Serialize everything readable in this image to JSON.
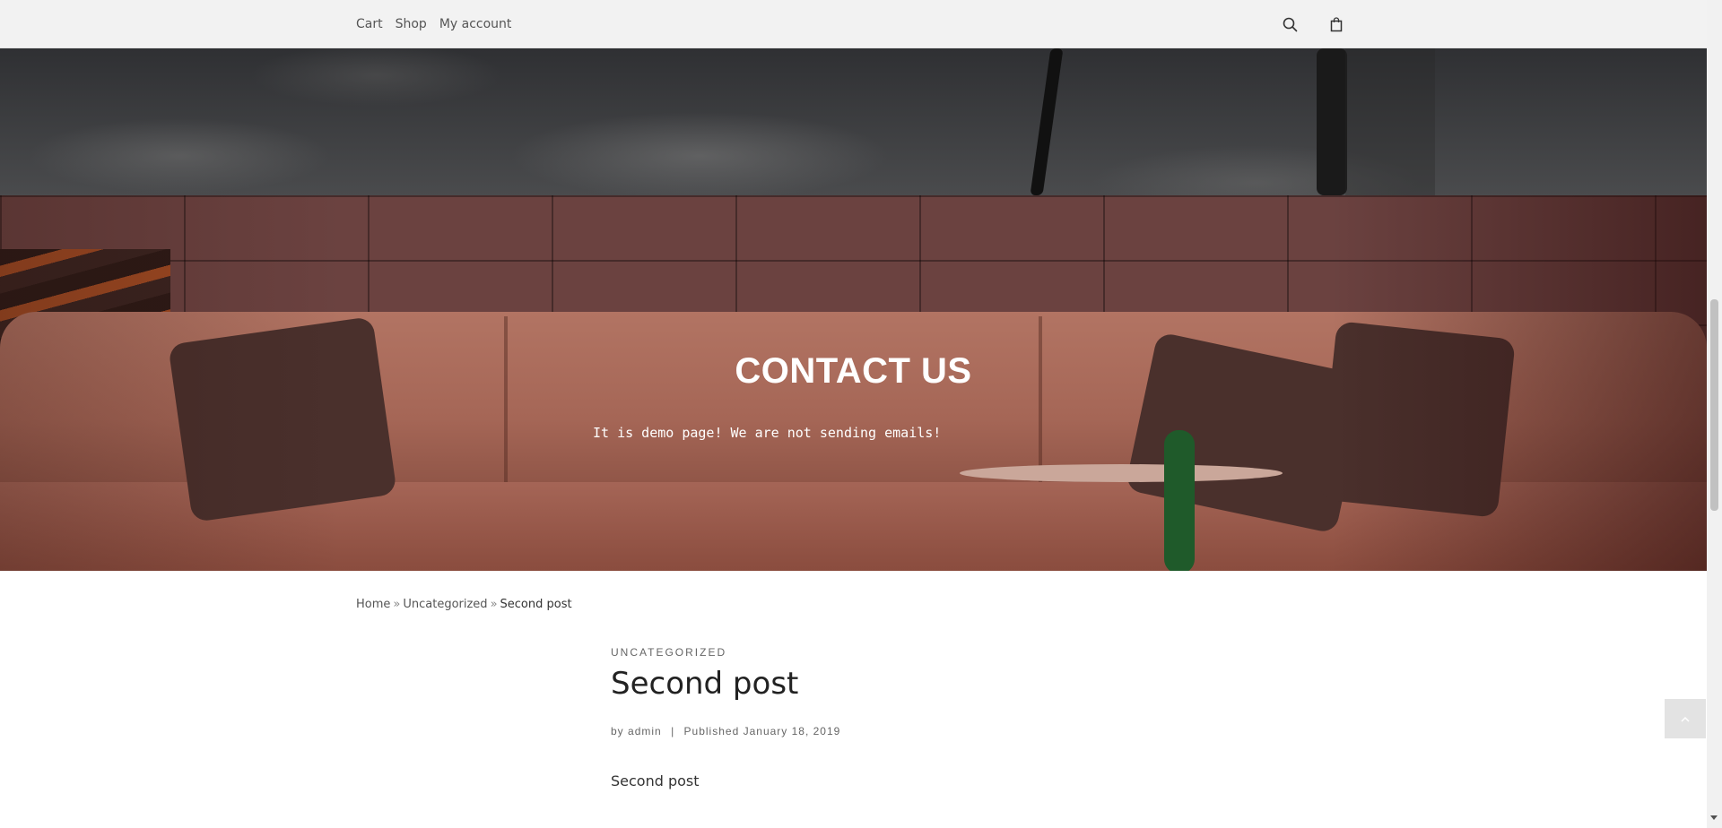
{
  "nav": {
    "items": [
      {
        "label": "Cart"
      },
      {
        "label": "Shop"
      },
      {
        "label": "My account"
      }
    ],
    "icons": {
      "search": "search-icon",
      "cart": "shopping-bag-icon"
    }
  },
  "hero": {
    "title": "CONTACT US",
    "subtitle": "It is demo page! We are not sending emails!"
  },
  "breadcrumb": {
    "home": "Home",
    "separator": "»",
    "category": "Uncategorized",
    "current": "Second post"
  },
  "post": {
    "category": "UNCATEGORIZED",
    "title": "Second post",
    "meta": {
      "by": "by",
      "author": "admin",
      "separator": "|",
      "published": "Published",
      "date": "January 18, 2019"
    },
    "body": "Second post"
  },
  "scroll_to_top": {
    "icon": "chevron-up-icon"
  },
  "colors": {
    "topbar": "#f2f2f2",
    "hero_base": "#6f3c33",
    "text": "#333333"
  }
}
